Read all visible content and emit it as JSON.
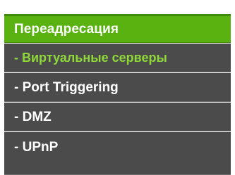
{
  "menu": {
    "header": {
      "label": "Переадресация"
    },
    "items": [
      {
        "label": "- Виртуальные серверы",
        "active": true
      },
      {
        "label": "- Port Triggering",
        "active": false
      },
      {
        "label": "- DMZ",
        "active": false
      },
      {
        "label": "- UPnP",
        "active": false
      }
    ]
  },
  "colors": {
    "header_bg": "#59b210",
    "item_bg": "#4b4b4b",
    "active_text": "#8fd83a",
    "text": "#ffffff"
  }
}
